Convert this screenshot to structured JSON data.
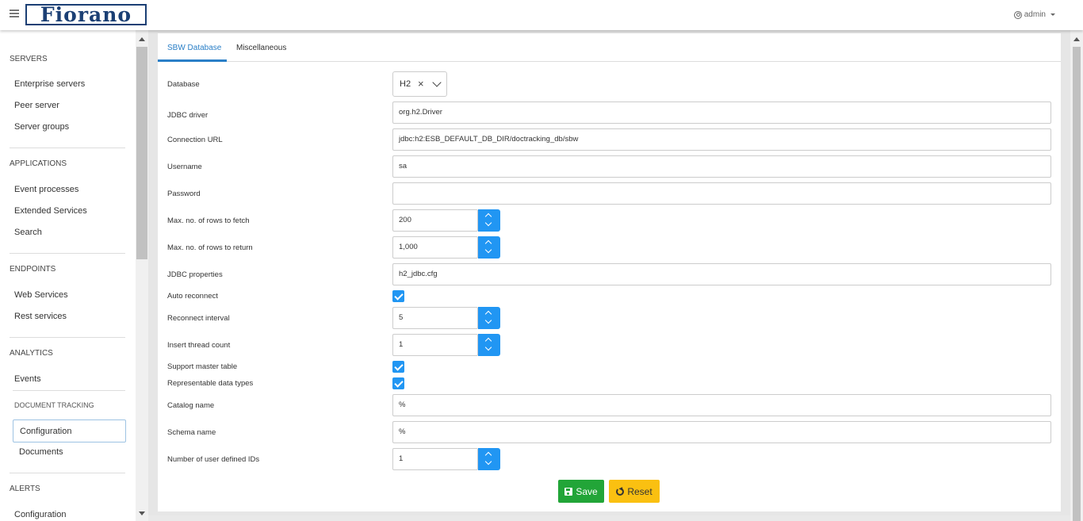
{
  "header": {
    "logo_text": "Fiorano",
    "user": "admin"
  },
  "sidebar": {
    "sections": {
      "servers": "SERVERS",
      "applications": "APPLICATIONS",
      "endpoints": "ENDPOINTS",
      "analytics": "ANALYTICS",
      "alerts": "ALERTS"
    },
    "items": {
      "enterprise_servers": "Enterprise servers",
      "peer_server": "Peer server",
      "server_groups": "Server groups",
      "event_processes": "Event processes",
      "extended_services": "Extended Services",
      "search": "Search",
      "web_services": "Web Services",
      "rest_services": "Rest services",
      "events": "Events",
      "document_tracking": "DOCUMENT TRACKING",
      "configuration": "Configuration",
      "documents": "Documents",
      "alerts_configuration": "Configuration"
    }
  },
  "tabs": {
    "sbw_database": "SBW Database",
    "miscellaneous": "Miscellaneous"
  },
  "form": {
    "database": {
      "label": "Database",
      "value": "H2",
      "clear": "×"
    },
    "jdbc_driver": {
      "label": "JDBC driver",
      "value": "org.h2.Driver"
    },
    "connection_url": {
      "label": "Connection URL",
      "value": "jdbc:h2:ESB_DEFAULT_DB_DIR/doctracking_db/sbw"
    },
    "username": {
      "label": "Username",
      "value": "sa"
    },
    "password": {
      "label": "Password",
      "value": ""
    },
    "max_rows_fetch": {
      "label": "Max. no. of rows to fetch",
      "value": "200"
    },
    "max_rows_return": {
      "label": "Max. no. of rows to return",
      "value": "1,000"
    },
    "jdbc_properties": {
      "label": "JDBC properties",
      "value": "h2_jdbc.cfg"
    },
    "auto_reconnect": {
      "label": "Auto reconnect",
      "checked": true
    },
    "reconnect_interval": {
      "label": "Reconnect interval",
      "value": "5"
    },
    "insert_thread_count": {
      "label": "Insert thread count",
      "value": "1"
    },
    "support_master_table": {
      "label": "Support master table",
      "checked": true
    },
    "representable_data_types": {
      "label": "Representable data types",
      "checked": true
    },
    "catalog_name": {
      "label": "Catalog name",
      "value": "%"
    },
    "schema_name": {
      "label": "Schema name",
      "value": "%"
    },
    "user_defined_ids": {
      "label": "Number of user defined IDs",
      "value": "1"
    }
  },
  "buttons": {
    "save": "Save",
    "reset": "Reset"
  },
  "colors": {
    "primary": "#2196f3",
    "tab_active": "#2a7fc7",
    "save": "#22a538",
    "reset": "#fac011",
    "logo": "#1b3f74"
  }
}
